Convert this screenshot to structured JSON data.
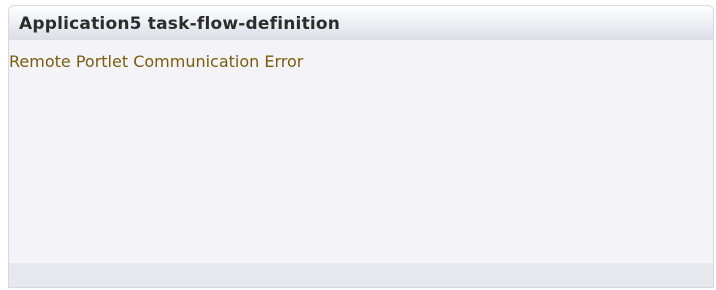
{
  "portlet": {
    "title": "Application5 task-flow-definition",
    "error_message": "Remote Portlet Communication Error"
  },
  "colors": {
    "panel_background": "#f4f4f8",
    "header_gradient_top": "#ffffff",
    "header_gradient_bottom": "#dcdee7",
    "title_text": "#2c2c2c",
    "error_text": "#7a5c10"
  }
}
